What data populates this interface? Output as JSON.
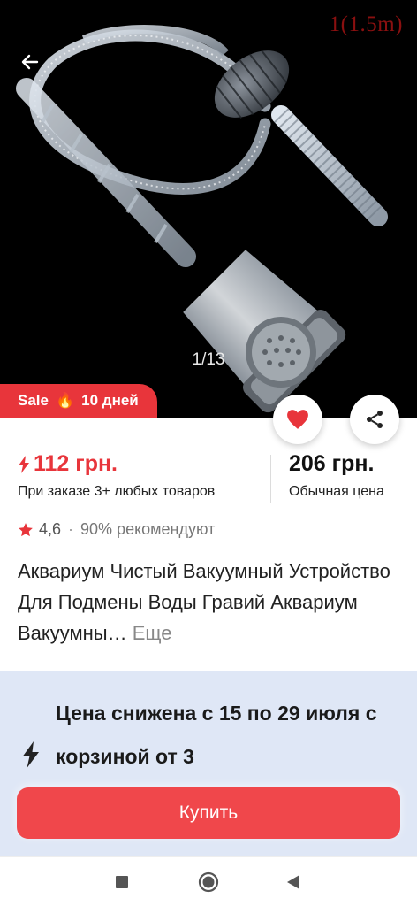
{
  "gallery": {
    "watermark": "1(1.5m)",
    "counter": "1/13",
    "back_icon": "arrow-left-icon"
  },
  "sale_badge": {
    "label": "Sale",
    "emoji": "🔥",
    "duration": "10 дней",
    "color": "#e8353b"
  },
  "actions": {
    "favorite_icon": "heart-icon",
    "share_icon": "share-icon"
  },
  "price": {
    "sale_price": "112 грн.",
    "sale_note": "При заказе 3+ любых товаров",
    "regular_price": "206 грн.",
    "regular_note": "Обычная цена",
    "accent_color": "#e8353b"
  },
  "rating": {
    "value": "4,6",
    "separator": "·",
    "recommend": "90% рекомендуют"
  },
  "product": {
    "title": "Аквариум Чистый Вакуумный Устройство Для Подмены Воды Гравий Аквариум Вакуумны…",
    "more_label": "Еще"
  },
  "promo": {
    "text": "Цена снижена с 15 по 29 июля с корзиной от 3",
    "icon": "bolt-icon"
  },
  "buy_button": {
    "label": "Купить",
    "color": "#f0474b"
  },
  "system_nav": {
    "recent_icon": "square-icon",
    "home_icon": "circle-icon",
    "back_icon": "triangle-back-icon"
  }
}
